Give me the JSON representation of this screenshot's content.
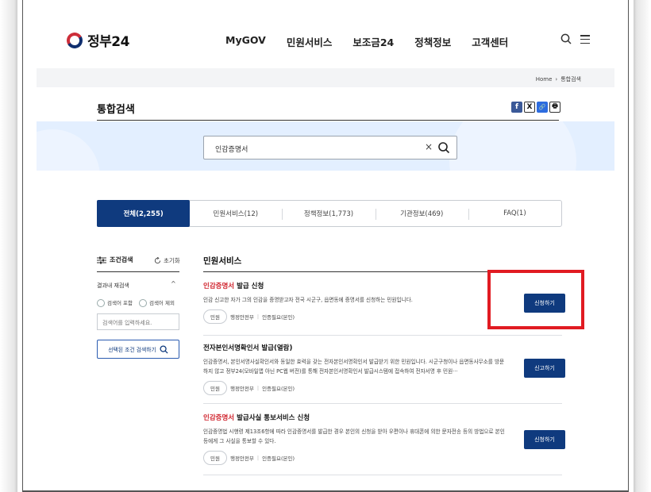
{
  "header": {
    "logo_text": "정부24",
    "nav": [
      "MyGOV",
      "민원서비스",
      "보조금24",
      "정책정보",
      "고객센터"
    ]
  },
  "breadcrumb": {
    "home": "Home",
    "separator": "›",
    "current": "통합검색"
  },
  "page_title": "통합검색",
  "share": [
    "f",
    "X",
    "🔗",
    "🖶"
  ],
  "search": {
    "value": "인감증명서",
    "clear": "×"
  },
  "tabs": [
    {
      "label": "전체(2,255)",
      "active": true
    },
    {
      "label": "민원서비스(12)",
      "active": false
    },
    {
      "label": "정책정보(1,773)",
      "active": false
    },
    {
      "label": "기관정보(469)",
      "active": false
    },
    {
      "label": "FAQ(1)",
      "active": false
    }
  ],
  "sidebar": {
    "title": "조건검색",
    "reset": "초기화",
    "sub": "결과내 재검색",
    "chevron": "^",
    "radio_include": "검색어 포함",
    "radio_exclude": "검색어 제외",
    "input_placeholder": "검색어를 입력하세요.",
    "apply_button": "선택된 조건 검색하기"
  },
  "results": {
    "section_title": "민원서비스",
    "items": [
      {
        "title_highlight": "인감증명서",
        "title_rest": " 발급 신청",
        "desc": "인감 신고한 자가 그의 인감을 증명받고자 전국 시군구, 읍면동에 증명서를 신청하는 민원입니다.",
        "tag": "민원",
        "org": "행정안전부",
        "auth": "인증필요(본인)",
        "button": "신청하기"
      },
      {
        "title_highlight": "",
        "title_rest": "전자본인서명확인서 발급(열람)",
        "desc": "인감증명서, 본인서명사실확인서와 동일한 효력을 갖는 전자본인서명확인서 발급받기 위한 민원입니다. 시군구청이나 읍면동사무소를 방문하지 않고 정부24(모바일앱 아닌 PC웹 버전)를 통해 전자본인서명확인서 발급시스템에 접속하여 전자서명 후 민원···",
        "tag": "민원",
        "org": "행정안전부",
        "auth": "인증필요(본인)",
        "button": "신고하기"
      },
      {
        "title_highlight": "인감증명서",
        "title_rest": " 발급사실 통보서비스 신청",
        "desc": "인감증명법 시행령 제13조6항에 따라 인감증명서를 발급한 경우 본인의 신청을 받아 우편이나 휴대폰에 의한 문자전송 등의 방법으로 본인 등에게 그 사실을 통보할 수 있다.",
        "tag": "민원",
        "org": "행정안전부",
        "auth": "인증필요(본인)",
        "button": "신청하기"
      }
    ]
  },
  "colors": {
    "primary": "#0f3a7e",
    "highlight": "#d0262f",
    "annotation": "#e11b22"
  }
}
